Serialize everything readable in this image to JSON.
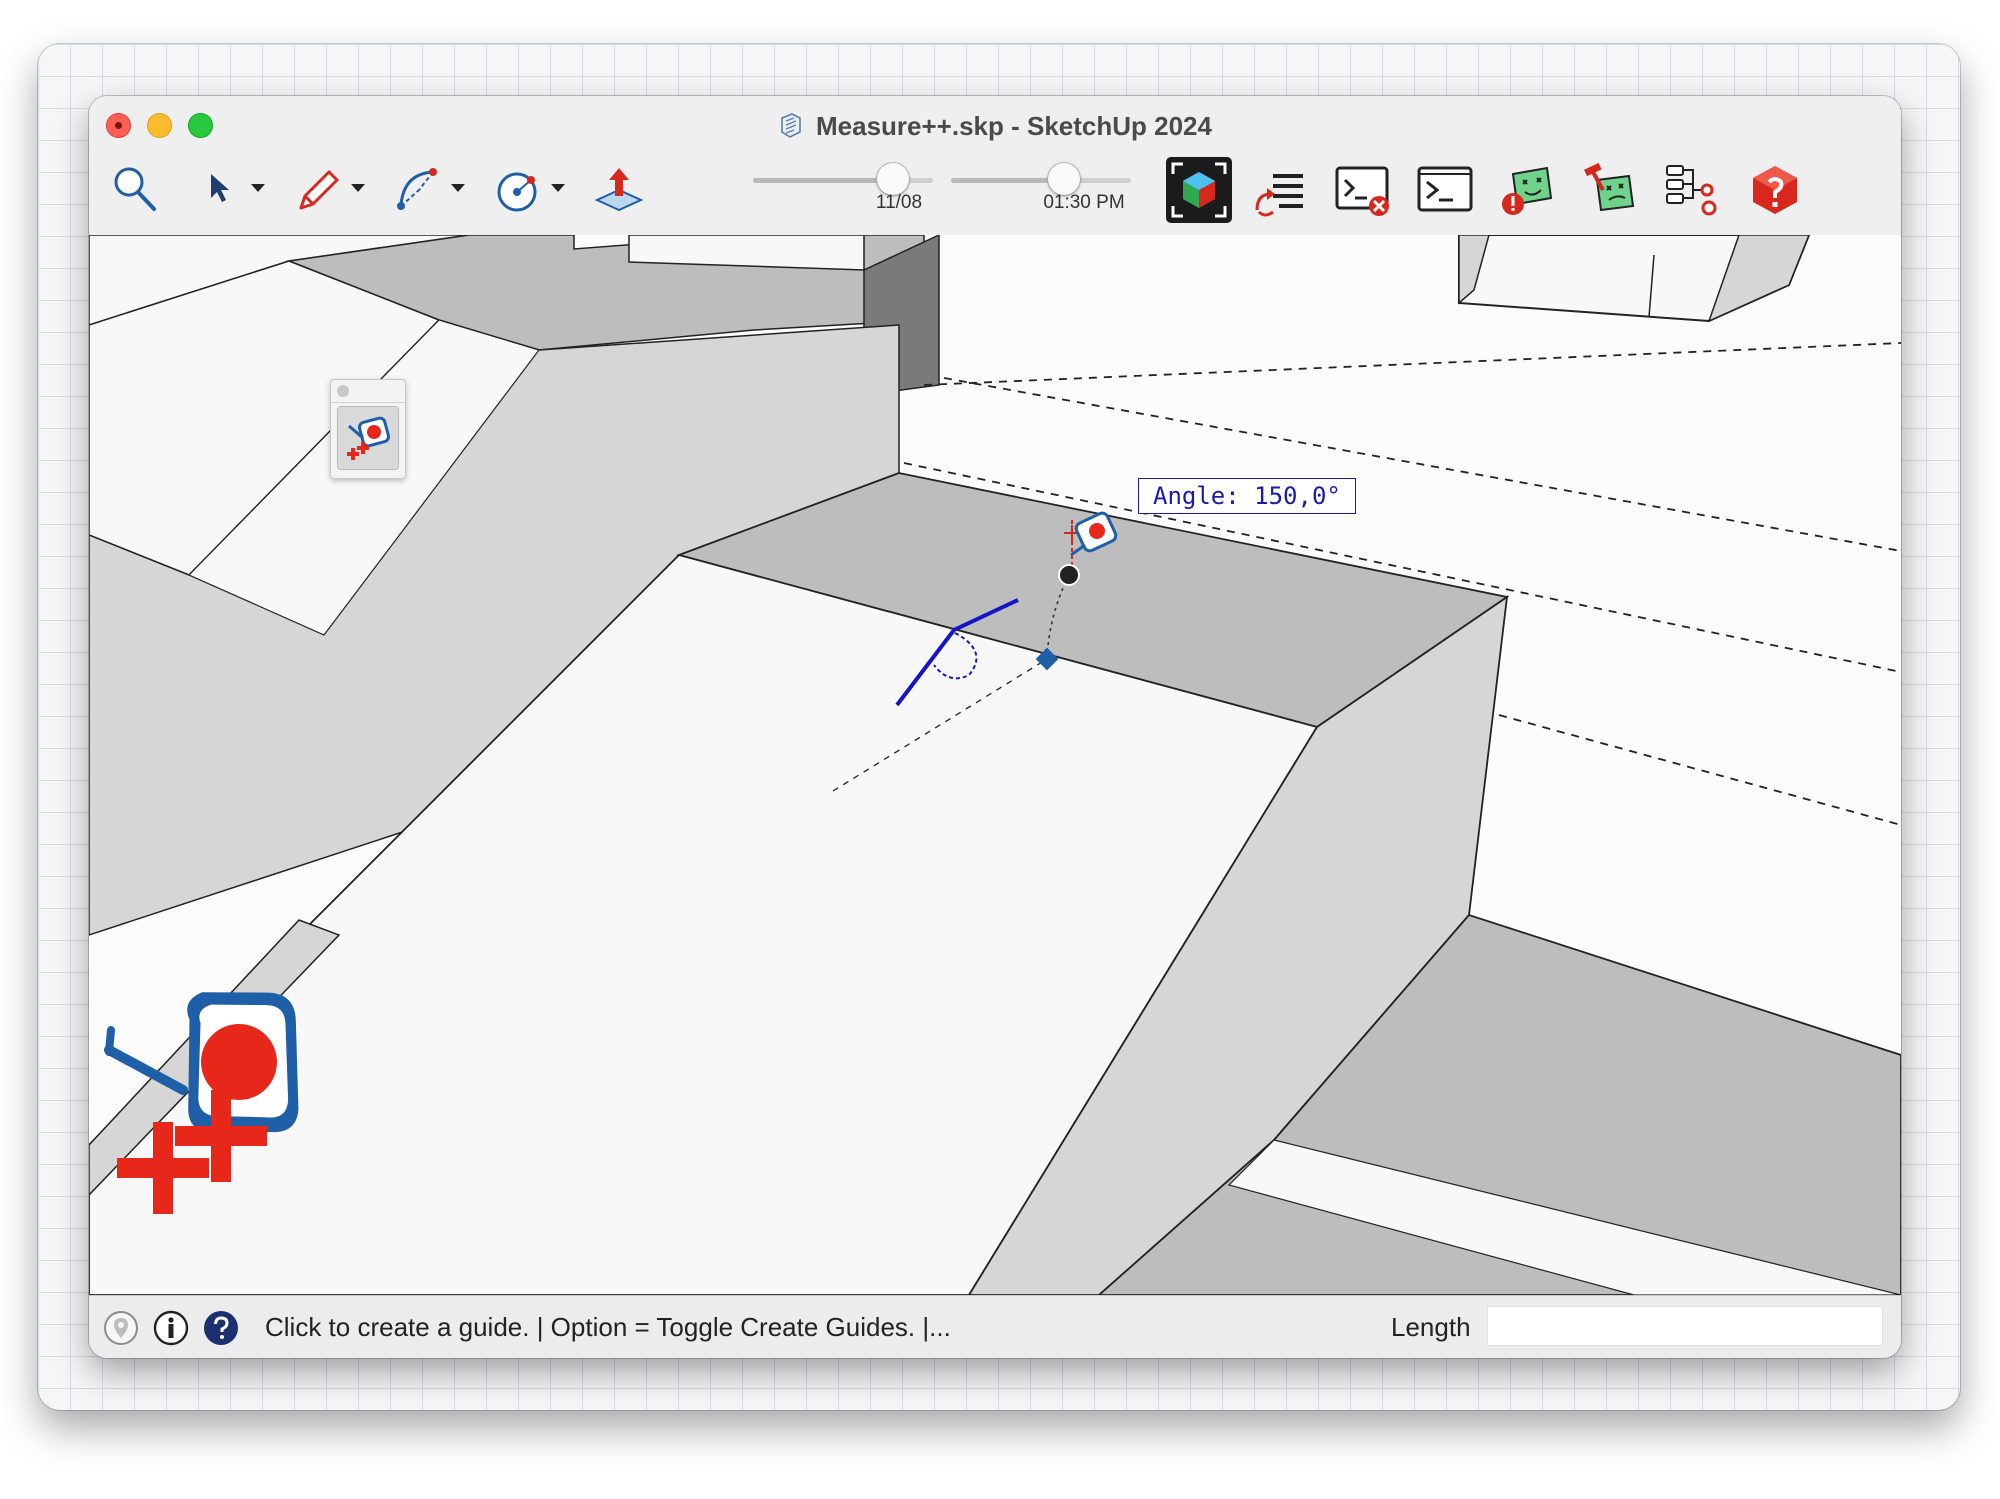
{
  "window": {
    "title": "Measure++.skp - SketchUp 2024",
    "file_icon": "sketchup-file-icon"
  },
  "toolbar": {
    "tools": [
      {
        "name": "zoom-icon"
      },
      {
        "name": "select-arrow-icon",
        "has_dropdown": true
      },
      {
        "name": "pencil-icon",
        "has_dropdown": true
      },
      {
        "name": "arc-icon",
        "has_dropdown": true
      },
      {
        "name": "circle-icon",
        "has_dropdown": true
      },
      {
        "name": "push-pull-icon"
      }
    ],
    "date_slider": {
      "label": "11/08",
      "value_fraction": 0.78
    },
    "time_slider": {
      "label": "01:30 PM",
      "value_fraction": 0.63
    },
    "extensions": [
      {
        "name": "cube-capture-icon",
        "selected": true
      },
      {
        "name": "reload-list-icon"
      },
      {
        "name": "close-console-icon"
      },
      {
        "name": "ruby-console-icon"
      },
      {
        "name": "error-face-icon"
      },
      {
        "name": "hammer-face-icon"
      },
      {
        "name": "node-tree-icon"
      },
      {
        "name": "ruby-gem-icon"
      }
    ]
  },
  "viewport": {
    "angle_readout": "Angle: 150,0°",
    "active_tool_icon": "measure-plus-plus-icon"
  },
  "status": {
    "message": "Click to create a guide. | Option = Toggle Create Guides. |...",
    "vcb_label": "Length",
    "vcb_value": "",
    "icons": [
      "geo-location-icon",
      "credits-icon",
      "help-icon"
    ]
  },
  "colors": {
    "accent_red": "#e8271b",
    "tool_blue": "#1f5fa8",
    "angle_blue": "#1a1ab0",
    "face_top": "#f8f8f8",
    "face_mid": "#bdbdbd",
    "face_side": "#d6d6d6"
  }
}
